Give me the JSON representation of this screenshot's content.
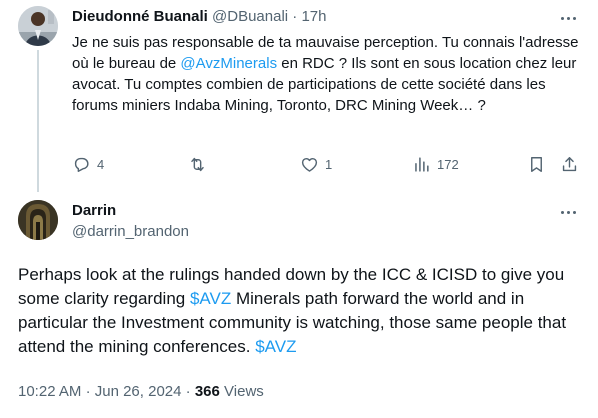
{
  "reply": {
    "name": "Dieudonné Buanali",
    "handle": "@DBuanali",
    "separator": "·",
    "time": "17h",
    "text_parts": [
      "Je ne suis pas responsable de ta mauvaise perception. Tu connais l'adresse où le bureau de ",
      "@AvzMinerals",
      " en RDC ? Ils sont en sous location chez leur avocat. Tu comptes combien de participations de cette société dans les forums miniers Indaba Mining, Toronto, DRC Mining Week… ?"
    ],
    "actions": {
      "replies": "4",
      "reposts": "",
      "likes": "1",
      "views": "172"
    },
    "icons": [
      "reply-icon",
      "repost-icon",
      "like-icon",
      "views-icon",
      "bookmark-icon",
      "share-icon",
      "more-icon"
    ]
  },
  "main": {
    "name": "Darrin",
    "handle": "@darrin_brandon",
    "text_parts": [
      "Perhaps look at the rulings handed down by the ICC & ICISD to give you some clarity regarding ",
      "$AVZ",
      " Minerals path forward the world and in particular the Investment community is watching, those same people that attend the mining conferences. ",
      "$AVZ"
    ],
    "meta": {
      "time": "10:22 AM",
      "sep1": "·",
      "date": "Jun 26, 2024",
      "sep2": "·",
      "views_count": "366",
      "views_label": "Views"
    }
  },
  "colors": {
    "link": "#1d9bf0",
    "secondary_text": "#536471",
    "primary_text": "#0f1419",
    "thread_line": "#cfd9de"
  }
}
